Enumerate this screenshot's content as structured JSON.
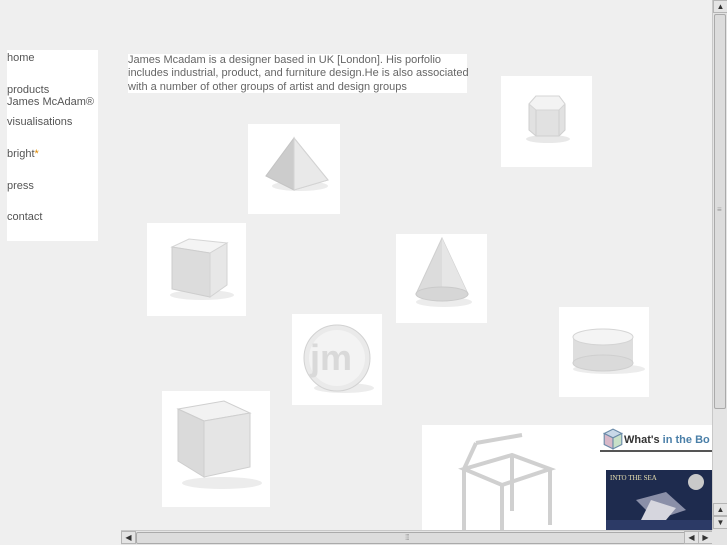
{
  "nav": {
    "home": "home",
    "products": "products",
    "james": "James McAdam®",
    "visualisations": "visualisations",
    "bright": "bright",
    "bright_star": "*",
    "press": "press",
    "contact": "contact"
  },
  "intro": {
    "line1": "James Mcadam is a designer based in UK [London]. His porfolio",
    "line2": "includes industrial, product, and furniture design.He is also associated",
    "line3": "with a number of other groups of artist and design groups"
  },
  "tiles": {
    "logo_text": "jm"
  },
  "promo": {
    "title_a": "What's",
    "title_b": " in the Bo",
    "book_text": "INTO THE SEA"
  },
  "colors": {
    "background": "#efefef",
    "panel": "#ffffff",
    "star": "#e08a00",
    "accent": "#4a7fa8"
  }
}
